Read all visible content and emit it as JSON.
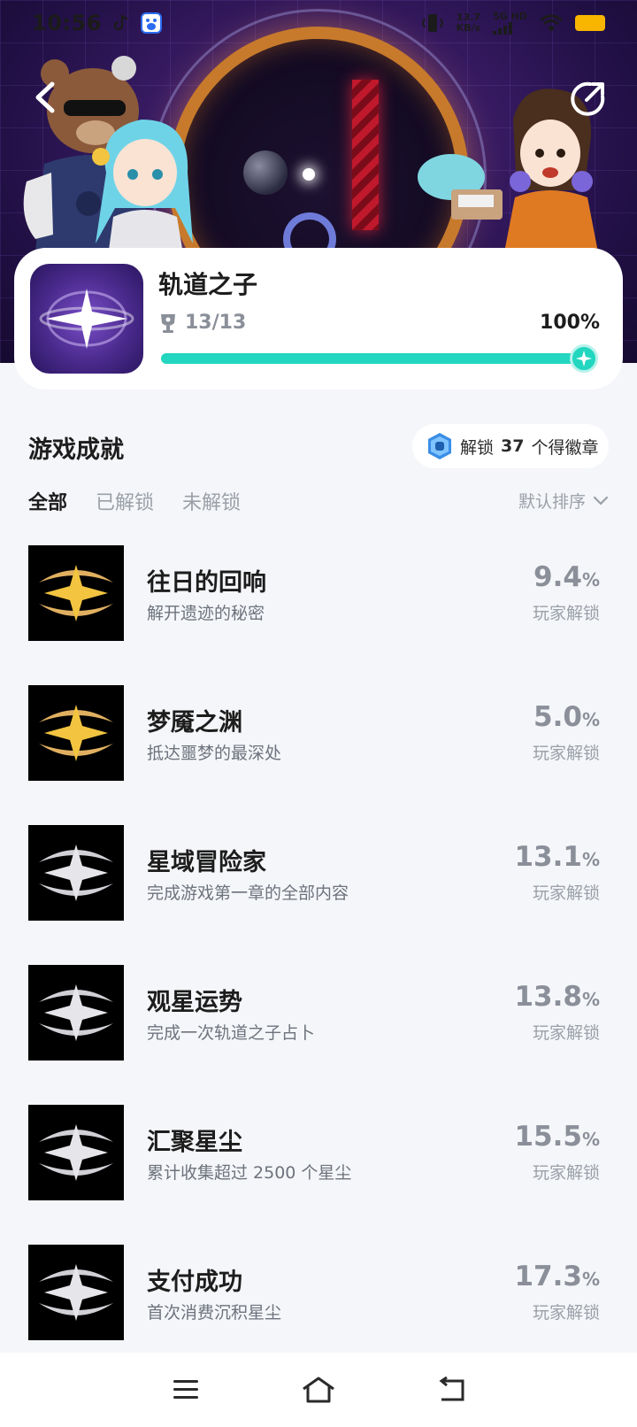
{
  "status_bar": {
    "time": "10:56",
    "net_speed_value": "13.7",
    "net_speed_unit": "KB/s",
    "network_type": "5G HD"
  },
  "game": {
    "title": "轨道之子",
    "trophy_count": "13/13",
    "completion": "100%",
    "progress_fraction": 1.0
  },
  "achievements_section": {
    "title": "游戏成就",
    "badge_prefix": "解锁",
    "badge_count": "37",
    "badge_suffix": "个得徽章",
    "tabs": [
      "全部",
      "已解锁",
      "未解锁"
    ],
    "active_tab": 0,
    "sort_label": "默认排序"
  },
  "achievements": [
    {
      "name": "往日的回响",
      "desc": "解开遗迹的秘密",
      "rate": "9.4",
      "pct": "%",
      "label": "玩家解锁",
      "tier": "gold"
    },
    {
      "name": "梦魇之渊",
      "desc": "抵达噩梦的最深处",
      "rate": "5.0",
      "pct": "%",
      "label": "玩家解锁",
      "tier": "gold"
    },
    {
      "name": "星域冒险家",
      "desc": "完成游戏第一章的全部内容",
      "rate": "13.1",
      "pct": "%",
      "label": "玩家解锁",
      "tier": "silver"
    },
    {
      "name": "观星运势",
      "desc": "完成一次轨道之子占卜",
      "rate": "13.8",
      "pct": "%",
      "label": "玩家解锁",
      "tier": "silver"
    },
    {
      "name": "汇聚星尘",
      "desc": "累计收集超过 2500 个星尘",
      "rate": "15.5",
      "pct": "%",
      "label": "玩家解锁",
      "tier": "silver"
    },
    {
      "name": "支付成功",
      "desc": "首次消费沉积星尘",
      "rate": "17.3",
      "pct": "%",
      "label": "玩家解锁",
      "tier": "silver"
    }
  ],
  "colors": {
    "accent": "#22d6c0",
    "gold": "#f2c440",
    "silver": "#e6e6ea",
    "banner": "#3a1c66"
  },
  "icons": {
    "back": "chevron-left-icon",
    "share": "share-icon",
    "trophy": "trophy-icon",
    "badge": "badge-icon",
    "sort": "chevron-down-icon",
    "nav": [
      "menu-icon",
      "home-icon",
      "back-icon"
    ]
  }
}
